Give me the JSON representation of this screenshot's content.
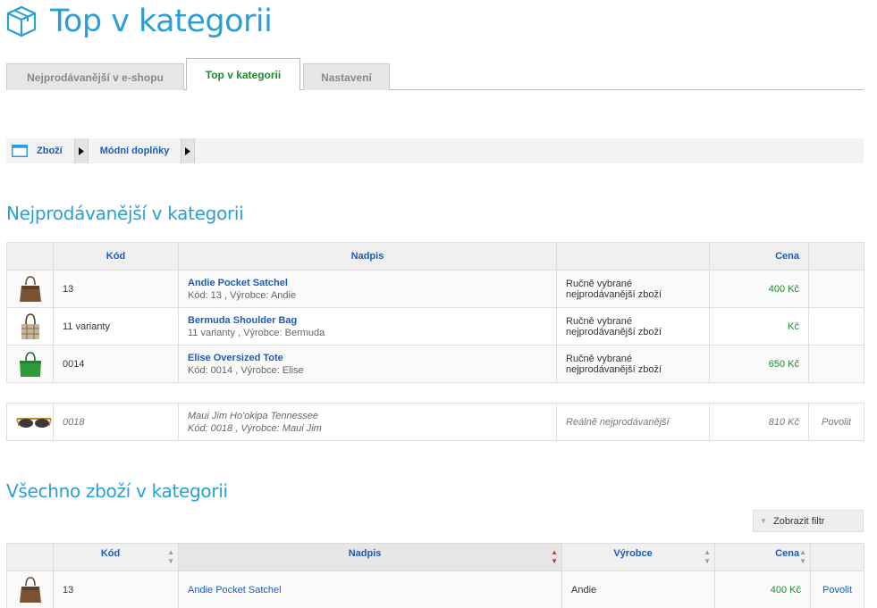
{
  "page": {
    "title": "Top v kategorii"
  },
  "tabs": [
    {
      "label": "Nejprodávanější v e-shopu"
    },
    {
      "label": "Top v kategorii"
    },
    {
      "label": "Nastavení"
    }
  ],
  "breadcrumb": {
    "items": [
      "Zboží",
      "Módní doplňky"
    ]
  },
  "bestsellers": {
    "title": "Nejprodávanější v kategorii",
    "headers": {
      "code": "Kód",
      "title": "Nadpis",
      "price": "Cena"
    },
    "rows": [
      {
        "thumb": "brown-handbag",
        "code": "13",
        "name": "Andie Pocket Satchel",
        "sub": "Kód: 13 , Výrobce: Andie",
        "type": "Ručně vybrané nejprodávanější zboží",
        "price": "400 Kč"
      },
      {
        "thumb": "plaid-handbag",
        "code": "11 varianty",
        "name": "Bermuda Shoulder Bag",
        "sub": "11 varianty , Výrobce: Bermuda",
        "type": "Ručně vybrané nejprodávanější zboží",
        "price": "Kč"
      },
      {
        "thumb": "green-tote",
        "code": "0014",
        "name": "Elise Oversized Tote",
        "sub": "Kód: 0014 , Výrobce: Elise",
        "type": "Ručně vybrané nejprodávanější zboží",
        "price": "650 Kč"
      }
    ],
    "auto_row": {
      "thumb": "sunglasses",
      "code": "0018",
      "name": "Maui Jim Ho'okipa Tennessee",
      "sub": "Kód: 0018 , Výrobce: Maui Jim",
      "type": "Reálně nejprodávanější",
      "price": "810 Kč",
      "action": "Povolit"
    }
  },
  "all_products": {
    "title": "Všechno zboží v kategorii",
    "filter_button": "Zobrazit filtr",
    "headers": {
      "code": "Kód",
      "title": "Nadpis",
      "maker": "Výrobce",
      "price": "Cena"
    },
    "rows": [
      {
        "thumb": "brown-handbag",
        "code": "13",
        "name": "Andie Pocket Satchel",
        "maker": "Andie",
        "price": "400 Kč",
        "action": "Povolit"
      }
    ]
  },
  "colors": {
    "accent": "#2a9fd6",
    "link": "#1d5bb8",
    "price": "#1f8a2e",
    "active_tab": "#1f8a2e"
  }
}
